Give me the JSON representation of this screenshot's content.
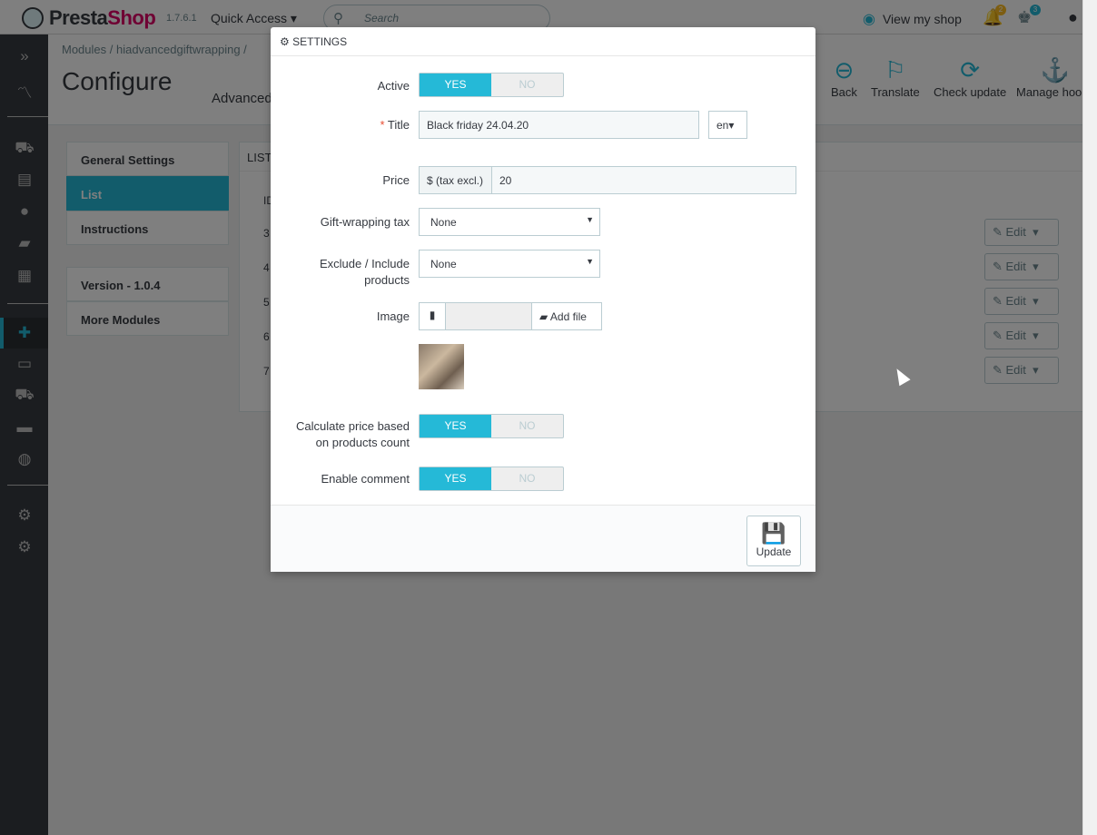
{
  "topbar": {
    "logo_presta": "Presta",
    "logo_shop": "Shop",
    "version": "1.7.6.1",
    "quick_access": "Quick Access ▾",
    "search_placeholder": "Search",
    "view_shop": "View my shop",
    "notif_orders_count": "2",
    "notif_customers_count": "3"
  },
  "header": {
    "breadcrumb": "Modules  /  hiadvancedgiftwrapping  /",
    "title": "Configure",
    "subtitle": "Advanced",
    "tools": [
      "Back",
      "Translate",
      "Check update",
      "Manage hooks"
    ]
  },
  "left_menu": {
    "items": [
      "General Settings",
      "List",
      "Instructions"
    ],
    "extra": [
      "Version - 1.0.4",
      "More Modules"
    ]
  },
  "list_panel": {
    "title": "LIST",
    "id_header": "ID",
    "rows": [
      "3",
      "4",
      "5",
      "6",
      "7"
    ],
    "edit_label": "Edit"
  },
  "modal": {
    "title": "SETTINGS",
    "active_label": "Active",
    "yes": "YES",
    "no": "NO",
    "title_label": "Title",
    "title_value": "Black friday 24.04.20",
    "lang": "en",
    "price_label": "Price",
    "price_prefix": "$ (tax excl.)",
    "price_value": "20",
    "tax_label": "Gift-wrapping tax",
    "tax_value": "None",
    "exclude_label_1": "Exclude / Include",
    "exclude_label_2": "products",
    "exclude_value": "None",
    "image_label": "Image",
    "add_file": "Add file",
    "calc_label_1": "Calculate price based",
    "calc_label_2": "on products count",
    "comment_label": "Enable comment",
    "update": "Update"
  },
  "colors": {
    "accent": "#25b9d7",
    "sidebar": "#363a41",
    "brand_pink": "#df0067"
  }
}
